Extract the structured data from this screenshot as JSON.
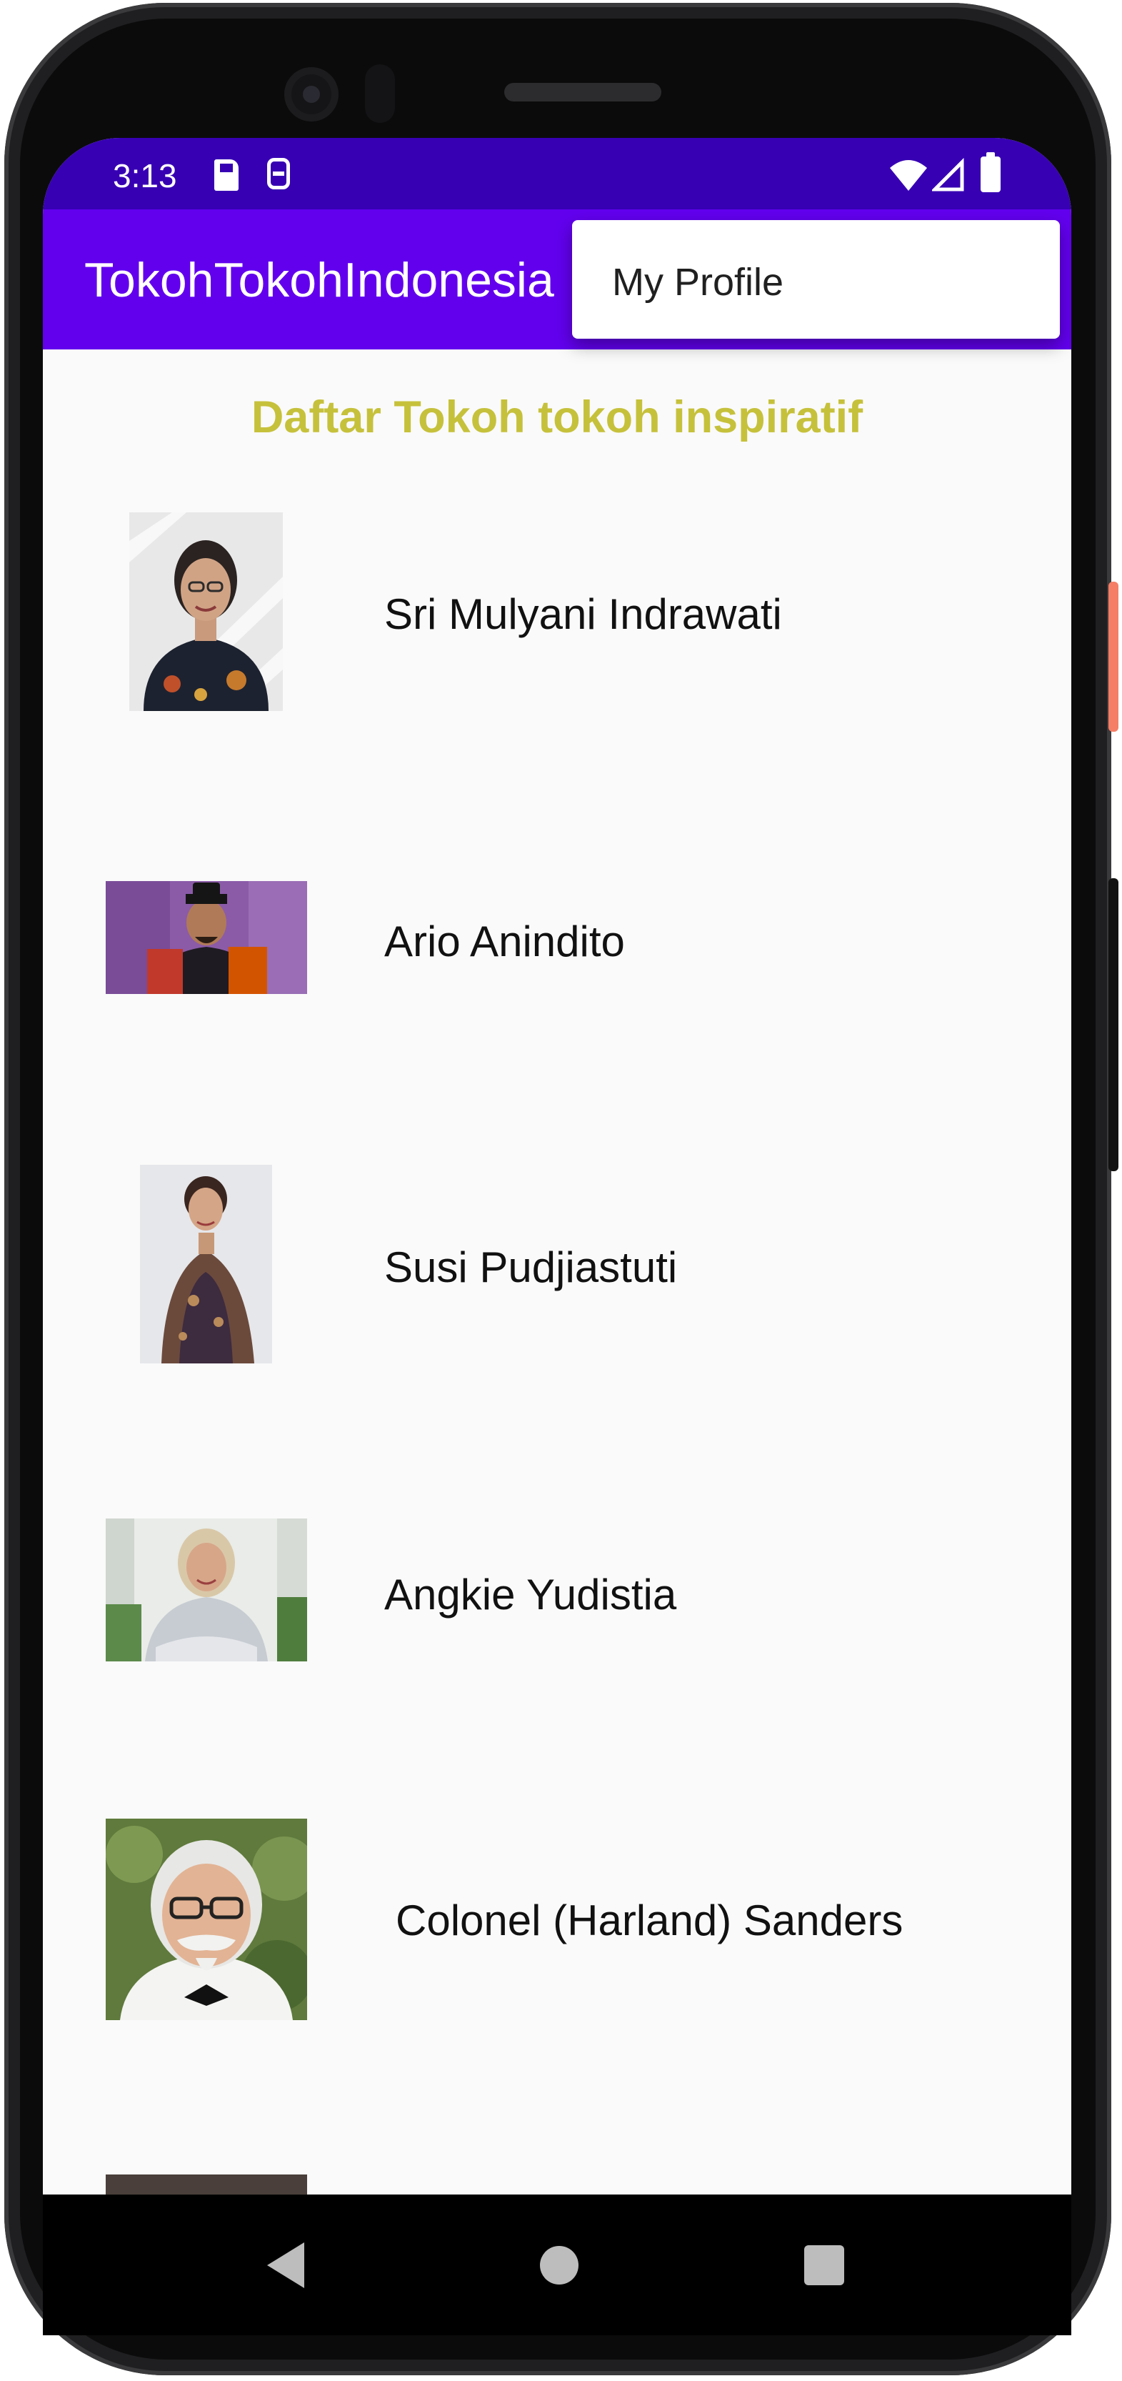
{
  "status_bar": {
    "time": "3:13",
    "icons": [
      "sd-card-icon",
      "sim-icon",
      "wifi-icon",
      "signal-icon",
      "battery-icon"
    ]
  },
  "app_bar": {
    "title": "TokohTokohIndonesia",
    "background": "#6200ee",
    "status_background": "#3700b3"
  },
  "overflow_menu": {
    "items": [
      {
        "label": "My Profile"
      }
    ]
  },
  "main": {
    "heading": "Daftar Tokoh tokoh inspiratif",
    "heading_color": "#c6c13b",
    "people": [
      {
        "name": "Sri Mulyani Indrawati"
      },
      {
        "name": "Ario Anindito"
      },
      {
        "name": "Susi Pudjiastuti"
      },
      {
        "name": "Angkie Yudistia"
      },
      {
        "name": "Colonel (Harland) Sanders"
      }
    ]
  },
  "nav_bar": {
    "icons": [
      "back-icon",
      "home-icon",
      "recents-icon"
    ]
  }
}
